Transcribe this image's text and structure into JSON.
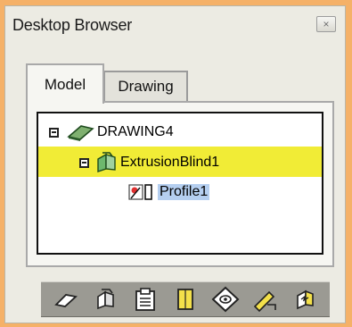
{
  "window": {
    "title": "Desktop Browser",
    "close_glyph": "×"
  },
  "tabs": [
    {
      "label": "Model",
      "active": true
    },
    {
      "label": "Drawing",
      "active": false
    }
  ],
  "tree": {
    "nodes": [
      {
        "label": "DRAWING4",
        "icon": "drawing-icon",
        "expanded": true
      },
      {
        "label": "ExtrusionBlind1",
        "icon": "extrusion-icon",
        "expanded": true,
        "highlighted": true
      },
      {
        "label": "Profile1",
        "icon": "profile-icon",
        "selected": true
      }
    ]
  },
  "toolbar": {
    "buttons": [
      "drawing-tool-icon",
      "extrude-tool-icon",
      "clipboard-tool-icon",
      "sheet-tool-icon",
      "diamond-view-icon",
      "pen-tool-icon",
      "update-tool-icon"
    ]
  },
  "colors": {
    "background": "#f5b168",
    "highlight_row": "#f1ec36",
    "selection": "#b5cff0",
    "toolbar": "#9b9a93"
  }
}
